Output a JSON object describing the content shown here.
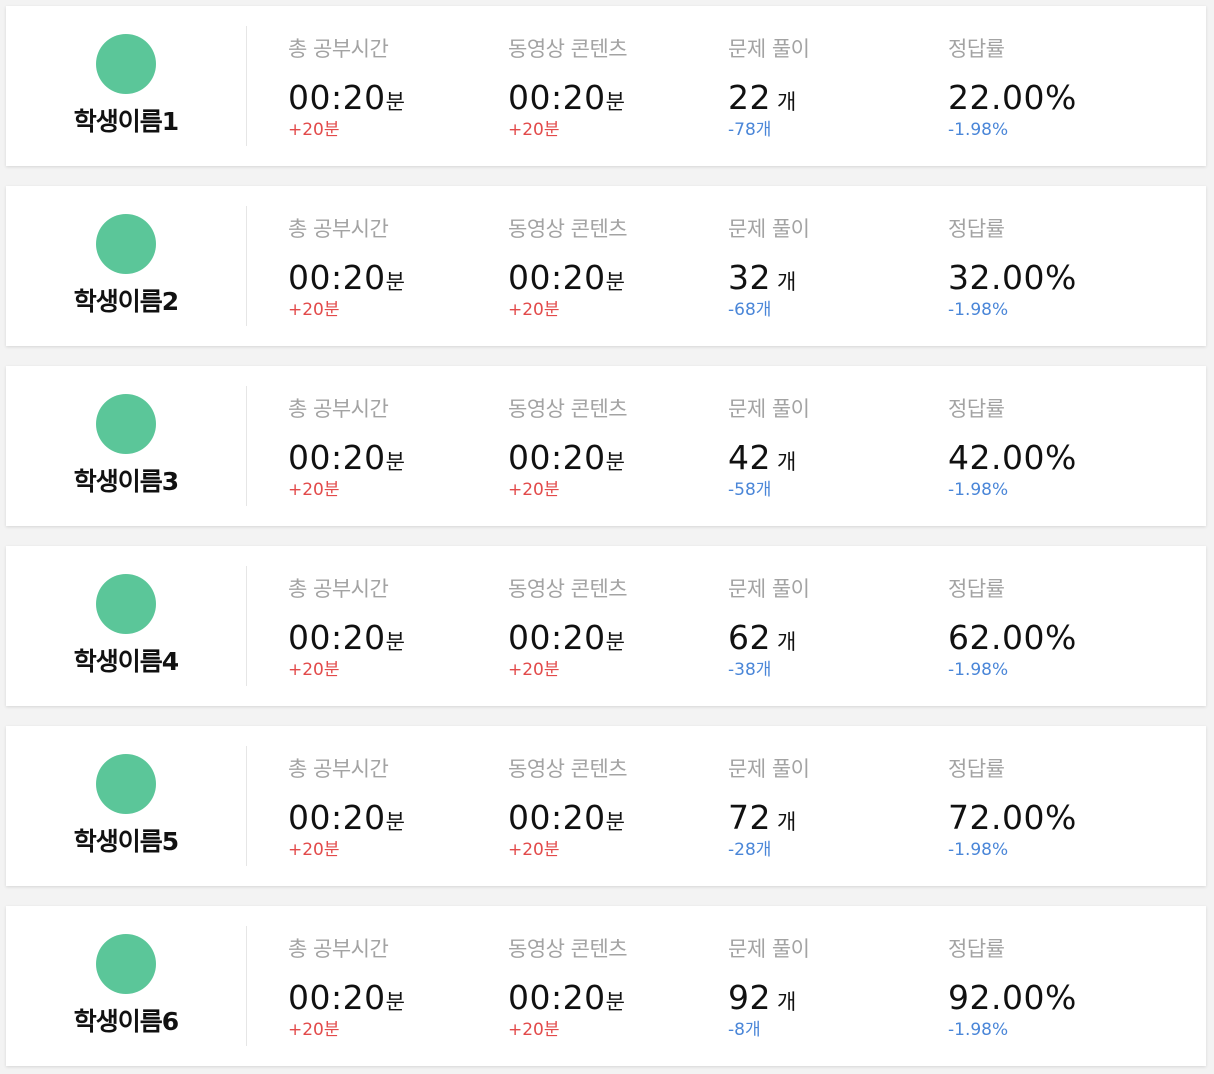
{
  "labels": {
    "total_study_time": "총 공부시간",
    "video_content": "동영상 콘텐츠",
    "problems_solved": "문제 풀이",
    "accuracy": "정답률"
  },
  "units": {
    "minutes": "분",
    "count": "개"
  },
  "colors": {
    "avatar": "#5bc699",
    "increase": "#e24a4a",
    "decrease": "#4a86d8"
  },
  "students": [
    {
      "name": "학생이름1",
      "total_time": "00:20",
      "total_time_delta": "+20분",
      "video_time": "00:20",
      "video_time_delta": "+20분",
      "problems": "22",
      "problems_delta": "-78개",
      "accuracy": "22.00%",
      "accuracy_delta": "-1.98%"
    },
    {
      "name": "학생이름2",
      "total_time": "00:20",
      "total_time_delta": "+20분",
      "video_time": "00:20",
      "video_time_delta": "+20분",
      "problems": "32",
      "problems_delta": "-68개",
      "accuracy": "32.00%",
      "accuracy_delta": "-1.98%"
    },
    {
      "name": "학생이름3",
      "total_time": "00:20",
      "total_time_delta": "+20분",
      "video_time": "00:20",
      "video_time_delta": "+20분",
      "problems": "42",
      "problems_delta": "-58개",
      "accuracy": "42.00%",
      "accuracy_delta": "-1.98%"
    },
    {
      "name": "학생이름4",
      "total_time": "00:20",
      "total_time_delta": "+20분",
      "video_time": "00:20",
      "video_time_delta": "+20분",
      "problems": "62",
      "problems_delta": "-38개",
      "accuracy": "62.00%",
      "accuracy_delta": "-1.98%"
    },
    {
      "name": "학생이름5",
      "total_time": "00:20",
      "total_time_delta": "+20분",
      "video_time": "00:20",
      "video_time_delta": "+20분",
      "problems": "72",
      "problems_delta": "-28개",
      "accuracy": "72.00%",
      "accuracy_delta": "-1.98%"
    },
    {
      "name": "학생이름6",
      "total_time": "00:20",
      "total_time_delta": "+20분",
      "video_time": "00:20",
      "video_time_delta": "+20분",
      "problems": "92",
      "problems_delta": "-8개",
      "accuracy": "92.00%",
      "accuracy_delta": "-1.98%"
    }
  ]
}
